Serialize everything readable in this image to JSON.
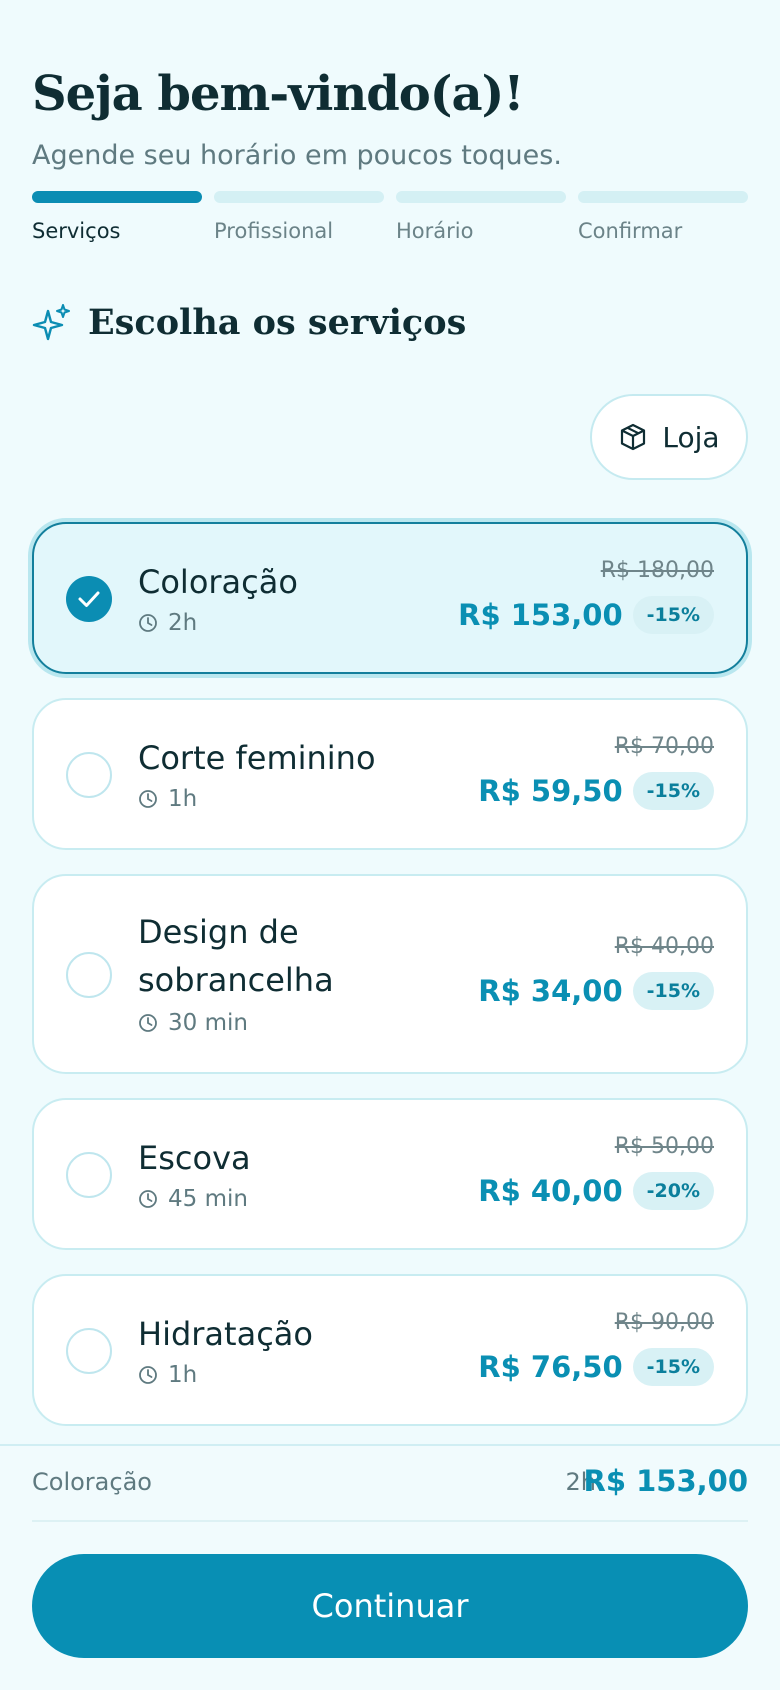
{
  "header": {
    "title": "Seja bem-vindo(a)!",
    "subtitle": "Agende seu horário em poucos toques."
  },
  "steps": [
    {
      "label": "Serviços",
      "active": true
    },
    {
      "label": "Profissional",
      "active": false
    },
    {
      "label": "Horário",
      "active": false
    },
    {
      "label": "Confirmar",
      "active": false
    }
  ],
  "section": {
    "title": "Escolha os serviços",
    "icon": "sparkles-icon"
  },
  "shop_button": {
    "label": "Loja",
    "icon": "package-icon"
  },
  "services": [
    {
      "name": "Coloração",
      "duration": "2h",
      "old_price": "R$ 180,00",
      "price": "R$ 153,00",
      "discount": "-15%",
      "selected": true
    },
    {
      "name": "Corte feminino",
      "duration": "1h",
      "old_price": "R$ 70,00",
      "price": "R$ 59,50",
      "discount": "-15%",
      "selected": false
    },
    {
      "name": "Design de sobrancelha",
      "duration": "30 min",
      "old_price": "R$ 40,00",
      "price": "R$ 34,00",
      "discount": "-15%",
      "selected": false
    },
    {
      "name": "Escova",
      "duration": "45 min",
      "old_price": "R$ 50,00",
      "price": "R$ 40,00",
      "discount": "-20%",
      "selected": false
    },
    {
      "name": "Hidratação",
      "duration": "1h",
      "old_price": "R$ 90,00",
      "price": "R$ 76,50",
      "discount": "-15%",
      "selected": false
    }
  ],
  "summary": {
    "name": "Coloração",
    "duration": "2h",
    "total": "R$ 153,00"
  },
  "cta": {
    "label": "Continuar"
  },
  "colors": {
    "accent": "#0b8db3",
    "background": "#effbfd",
    "selected_card": "#e2f7fb"
  }
}
